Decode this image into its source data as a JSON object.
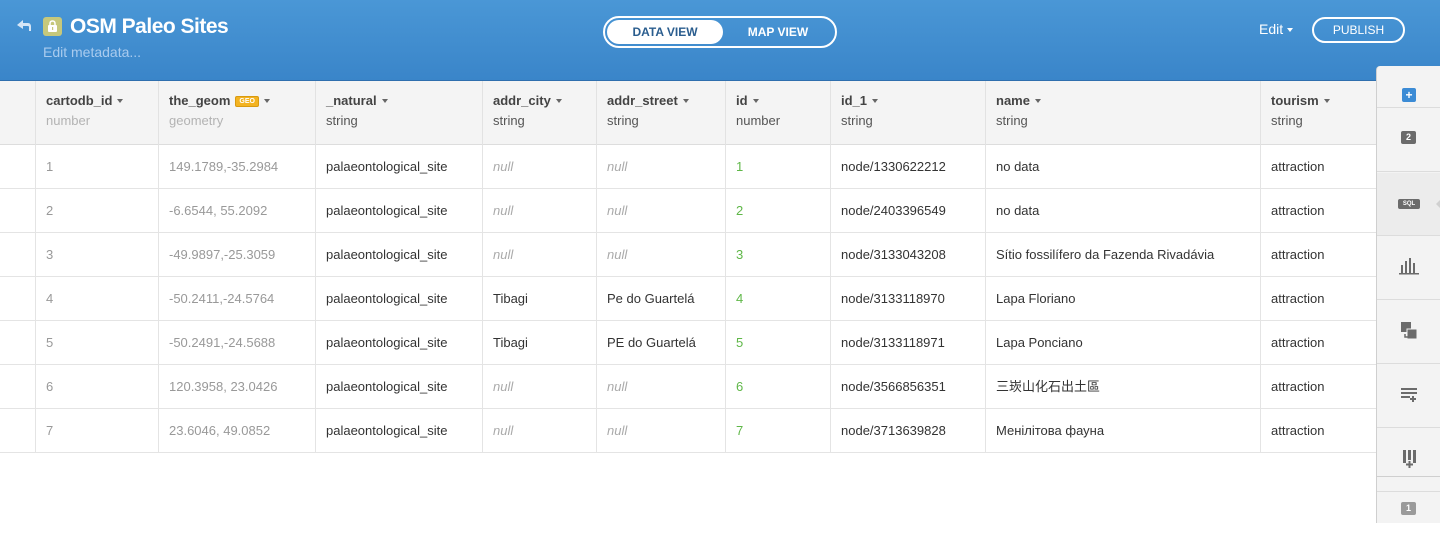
{
  "header": {
    "title": "OSM Paleo Sites",
    "subtitle": "Edit metadata...",
    "view_toggle": {
      "active": "DATA VIEW",
      "inactive": "MAP VIEW"
    },
    "edit_label": "Edit",
    "publish_label": "PUBLISH"
  },
  "table": {
    "columns": [
      {
        "name": "cartodb_id",
        "type": "number",
        "type_muted": true
      },
      {
        "name": "the_geom",
        "type": "geometry",
        "type_muted": true,
        "badge": "GEO"
      },
      {
        "name": "_natural",
        "type": "string"
      },
      {
        "name": "addr_city",
        "type": "string"
      },
      {
        "name": "addr_street",
        "type": "string"
      },
      {
        "name": "id",
        "type": "number"
      },
      {
        "name": "id_1",
        "type": "string"
      },
      {
        "name": "name",
        "type": "string"
      },
      {
        "name": "tourism",
        "type": "string"
      }
    ],
    "rows": [
      [
        "1",
        "149.1789,-35.2984",
        "palaeontological_site",
        "null",
        "null",
        "1",
        "node/1330622212",
        "no data",
        "attraction"
      ],
      [
        "2",
        "-6.6544, 55.2092",
        "palaeontological_site",
        "null",
        "null",
        "2",
        "node/2403396549",
        "no data",
        "attraction"
      ],
      [
        "3",
        "-49.9897,-25.3059",
        "palaeontological_site",
        "null",
        "null",
        "3",
        "node/3133043208",
        "Sítio fossilífero da Fazenda Rivadávia",
        "attraction"
      ],
      [
        "4",
        "-50.2411,-24.5764",
        "palaeontological_site",
        "Tibagi",
        "Pe do Guartelá",
        "4",
        "node/3133118970",
        "Lapa Floriano",
        "attraction"
      ],
      [
        "5",
        "-50.2491,-24.5688",
        "palaeontological_site",
        "Tibagi",
        "PE do Guartelá",
        "5",
        "node/3133118971",
        "Lapa Ponciano",
        "attraction"
      ],
      [
        "6",
        "120.3958, 23.0426",
        "palaeontological_site",
        "null",
        "null",
        "6",
        "node/3566856351",
        "三崁山化石出土區",
        "attraction"
      ],
      [
        "7",
        "23.6046, 49.0852",
        "palaeontological_site",
        "null",
        "null",
        "7",
        "node/3713639828",
        "Менілітова фауна",
        "attraction"
      ]
    ]
  },
  "sidebar": {
    "items": [
      {
        "icon": "add-layer-icon"
      },
      {
        "icon": "layer-2-icon",
        "label": "2"
      },
      {
        "icon": "sql-icon",
        "label": "SQL"
      },
      {
        "icon": "histogram-icon"
      },
      {
        "icon": "merge-tables-icon"
      },
      {
        "icon": "add-row-icon"
      },
      {
        "icon": "add-column-icon"
      },
      {
        "icon": "layer-1-icon",
        "label": "1"
      }
    ]
  },
  "colors": {
    "header_blue": "#4a97d6",
    "id_green": "#5fb748",
    "geo_badge": "#f3b321",
    "accent": "#3b8bd5"
  }
}
